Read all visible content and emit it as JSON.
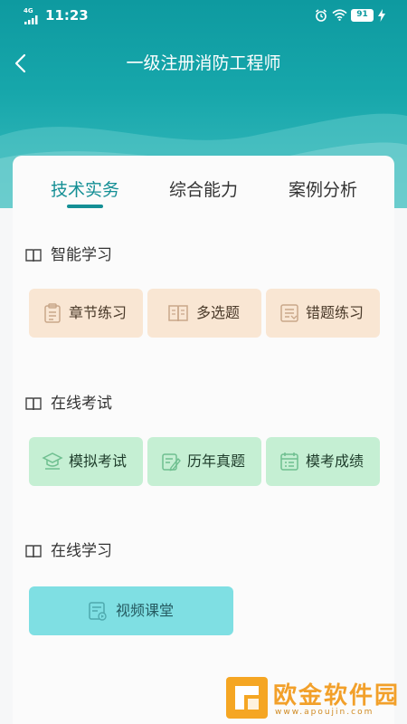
{
  "status_bar": {
    "network": "4G",
    "time": "11:23",
    "battery": "91"
  },
  "nav": {
    "title": "一级注册消防工程师"
  },
  "tabs": [
    {
      "label": "技术实务",
      "active": true
    },
    {
      "label": "综合能力",
      "active": false
    },
    {
      "label": "案例分析",
      "active": false
    }
  ],
  "sections": [
    {
      "title": "智能学习",
      "icon": "book-open-icon",
      "items": [
        {
          "label": "章节练习",
          "icon": "clipboard-list-icon"
        },
        {
          "label": "多选题",
          "icon": "book-icon"
        },
        {
          "label": "错题练习",
          "icon": "document-icon"
        }
      ]
    },
    {
      "title": "在线考试",
      "icon": "book-open-icon",
      "items": [
        {
          "label": "模拟考试",
          "icon": "graduation-cap-icon"
        },
        {
          "label": "历年真题",
          "icon": "pen-paper-icon"
        },
        {
          "label": "模考成绩",
          "icon": "calendar-list-icon"
        }
      ]
    },
    {
      "title": "在线学习",
      "icon": "book-open-icon",
      "items": [
        {
          "label": "视频课堂",
          "icon": "video-document-icon"
        }
      ]
    }
  ],
  "watermark": {
    "text": "欧金软件园",
    "url": "www.apoujin.com"
  },
  "colors": {
    "header": "#0e9aa0",
    "accent": "#148f95",
    "peach": "#f9e6d3",
    "green": "#c5efd3",
    "cyan": "#7fdfe3"
  }
}
